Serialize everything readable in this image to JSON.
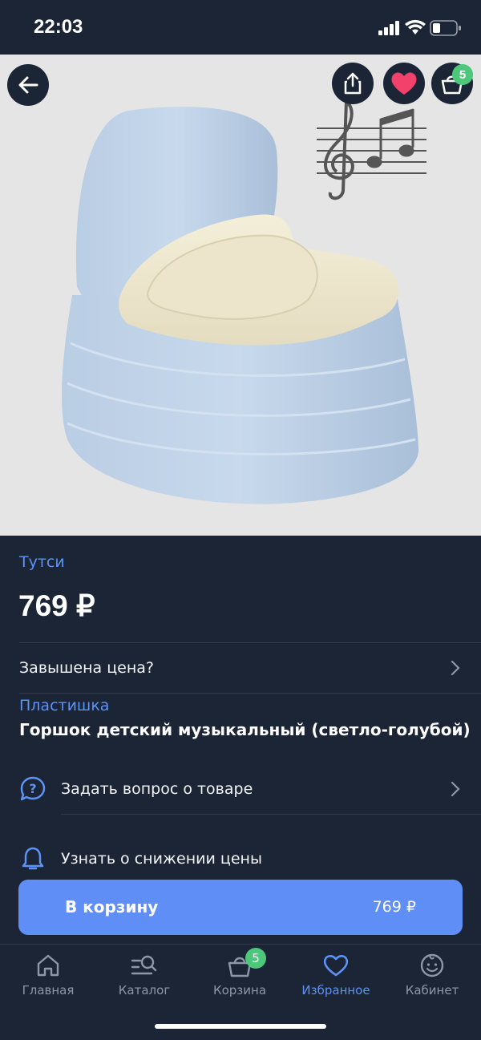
{
  "status": {
    "time": "22:03"
  },
  "product": {
    "brand": "Тутси",
    "price": "769 ₽",
    "price_complaint": "Завышена цена?",
    "category": "Пластишка",
    "title": "Горшок детский музыкальный (светло-голубой)"
  },
  "actions": {
    "ask_question": "Задать вопрос о товаре",
    "price_drop": "Узнать о снижении цены"
  },
  "header": {
    "cart_count": "5"
  },
  "cart_button": {
    "label": "В корзину",
    "price": "769 ₽"
  },
  "tabs": [
    {
      "label": "Главная",
      "icon": "home-icon"
    },
    {
      "label": "Каталог",
      "icon": "catalog-search-icon"
    },
    {
      "label": "Корзина",
      "icon": "basket-icon",
      "badge": "5"
    },
    {
      "label": "Избранное",
      "icon": "heart-icon",
      "active": true
    },
    {
      "label": "Кабинет",
      "icon": "smile-face-icon"
    }
  ],
  "colors": {
    "background": "#1b2536",
    "accent": "#5f8ff6",
    "link": "#5c93f5",
    "badge": "#4cc77b",
    "favorite": "#f2416b"
  }
}
